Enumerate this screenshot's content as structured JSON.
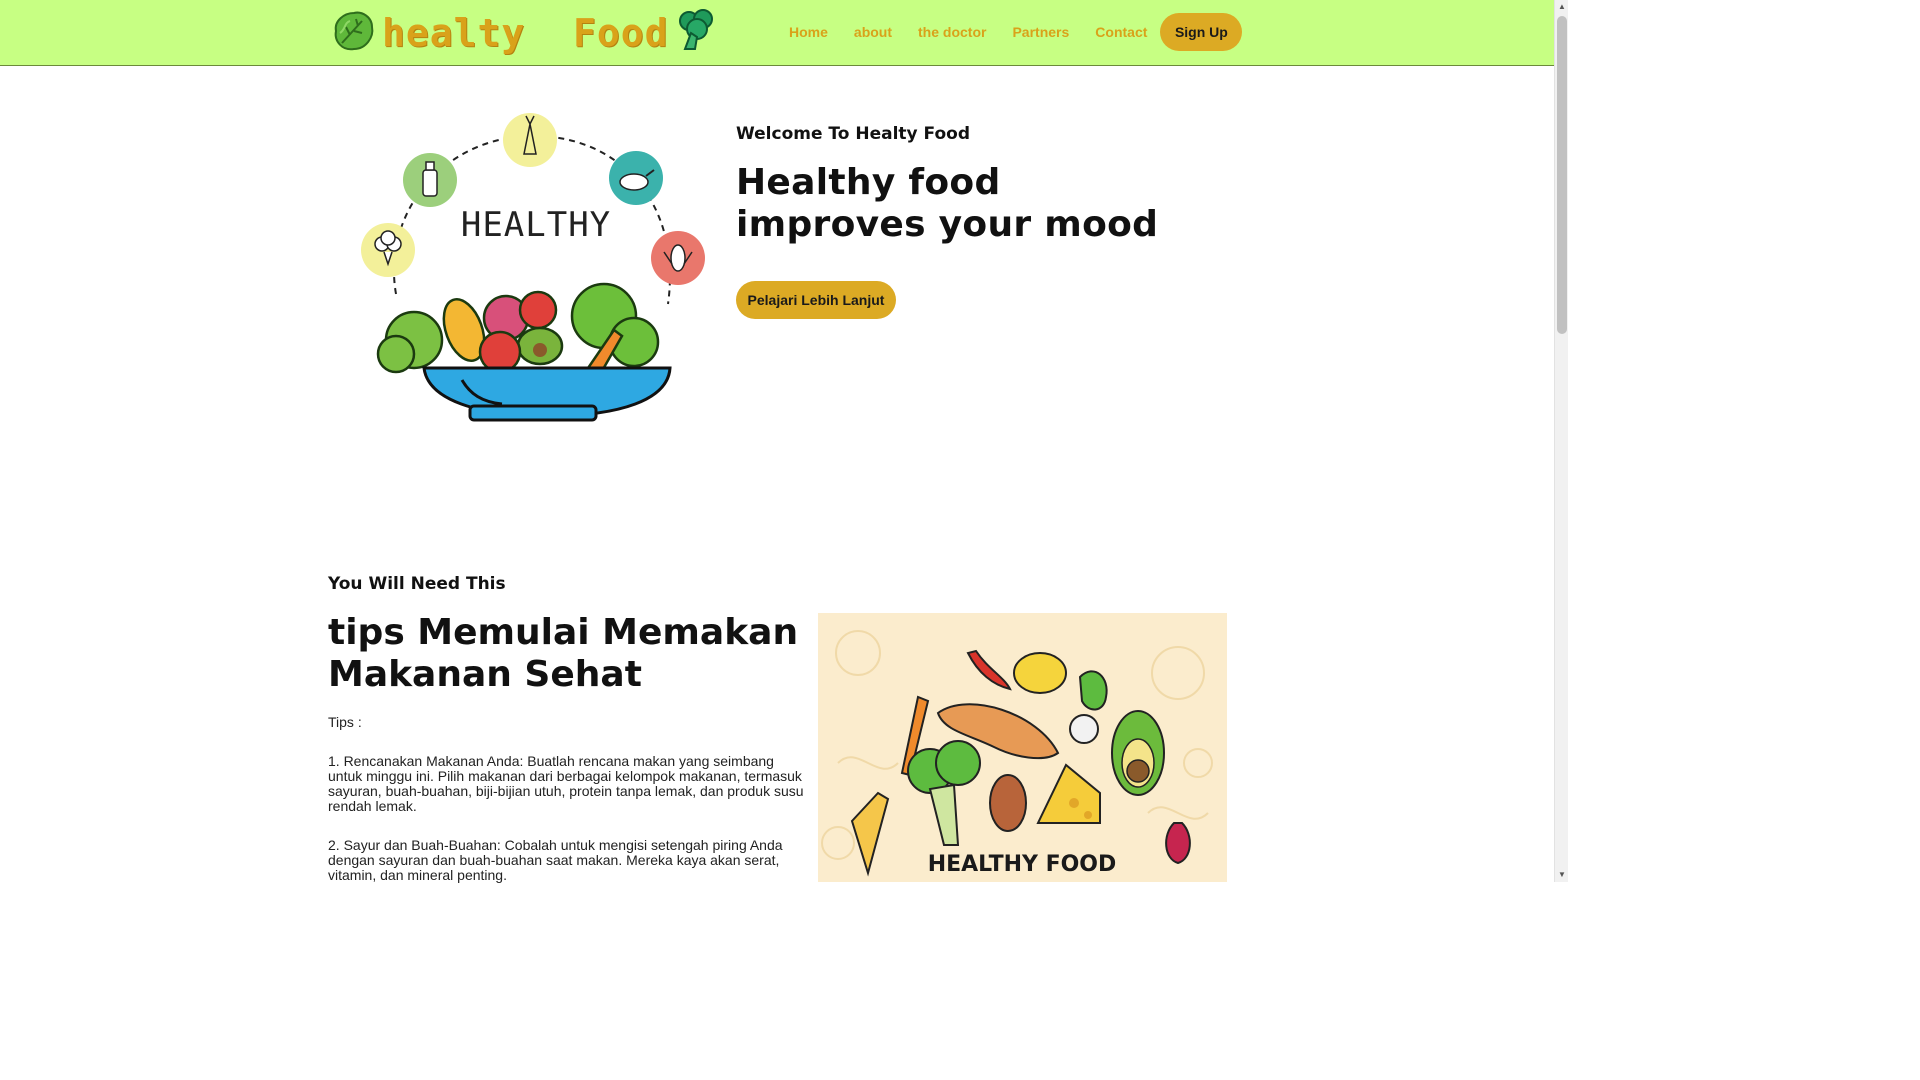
{
  "nav": {
    "brand": "healty  Food",
    "links": [
      "Home",
      "about",
      "the doctor",
      "Partners",
      "Contact"
    ],
    "signup": "Sign Up"
  },
  "hero": {
    "welcome": "Welcome To Healty Food",
    "title": "Healthy food improves your mood",
    "illustration_text": "HEALTHY",
    "button": "Pelajari Lebih Lanjut"
  },
  "tips": {
    "eyebrow": "You Will Need This",
    "title": "tips Memulai Memakan Makanan Sehat",
    "label": "Tips :",
    "items": [
      "1. Rencanakan Makanan Anda: Buatlah rencana makan yang seimbang untuk minggu ini. Pilih makanan dari berbagai kelompok makanan, termasuk sayuran, buah-buahan, biji-bijian utuh, protein tanpa lemak, dan produk susu rendah lemak.",
      "2. Sayur dan Buah-Buahan: Cobalah untuk mengisi setengah piring Anda dengan sayuran dan buah-buahan saat makan. Mereka kaya akan serat, vitamin, dan mineral penting."
    ],
    "image_text": "HEALTHY FOOD"
  },
  "colors": {
    "navbar": "#c7ff83",
    "accent": "#dcaa24",
    "brand_text": "#d9a21a"
  },
  "icons": [
    "lettuce-icon",
    "broccoli-icon",
    "carrot-icon",
    "milk-bottle-icon",
    "chicken-icon",
    "cauliflower-icon",
    "corn-icon"
  ]
}
